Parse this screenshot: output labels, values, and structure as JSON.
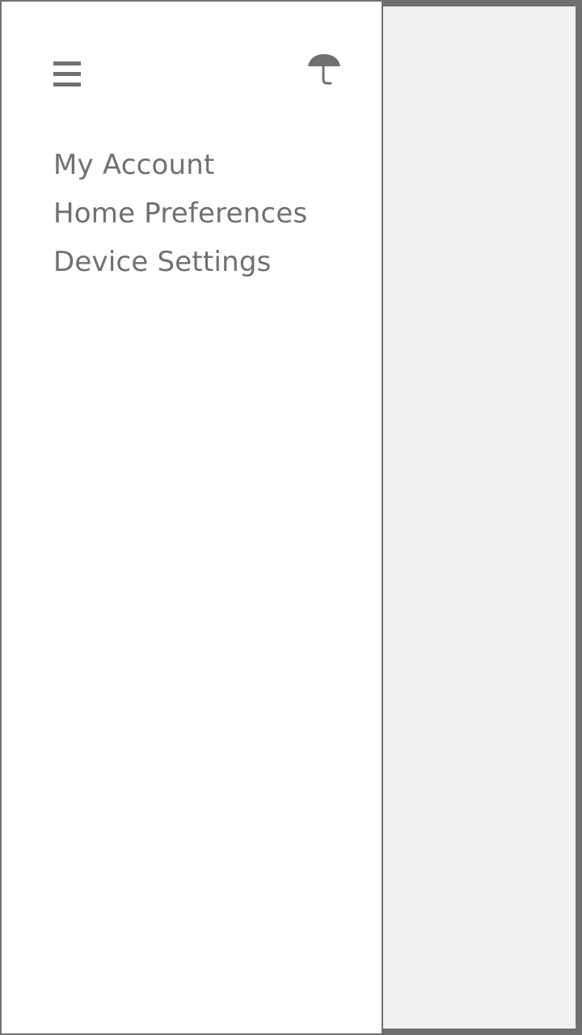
{
  "colors": {
    "overlay": "#6f6f6f",
    "content_background": "#f0f0f0",
    "drawer_background": "#ffffff",
    "foreground": "#707070"
  },
  "icons": {
    "menu": "hamburger-menu-icon",
    "brand": "umbrella-logo-icon"
  },
  "drawer": {
    "nav_items": [
      {
        "label": "My Account"
      },
      {
        "label": "Home Preferences"
      },
      {
        "label": "Device Settings"
      }
    ]
  }
}
